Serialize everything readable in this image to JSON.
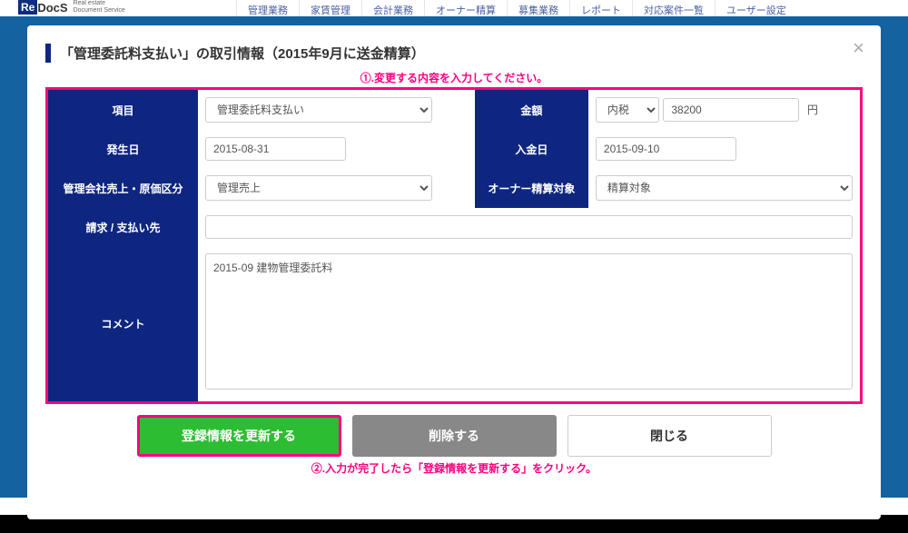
{
  "header": {
    "logo_prefix": "Re",
    "logo_main": "DocS",
    "logo_sub1": "Real estate",
    "logo_sub2": "Document Service"
  },
  "nav": [
    "管理業務",
    "家賃管理",
    "会計業務",
    "オーナー精算",
    "募集業務",
    "レポート",
    "対応案件一覧",
    "ユーザー設定"
  ],
  "modal": {
    "title": "「管理委託料支払い」の取引情報（2015年9月に送金精算）",
    "annotation1": "①.変更する内容を入力してください。",
    "annotation2": "②.入力が完了したら「登録情報を更新する」をクリック。",
    "labels": {
      "item": "項目",
      "amount": "金額",
      "occurrence_date": "発生日",
      "deposit_date": "入金日",
      "sales_category": "管理会社売上・原価区分",
      "owner_target": "オーナー精算対象",
      "billing_to": "請求 / 支払い先",
      "comment": "コメント"
    },
    "values": {
      "item": "管理委託料支払い",
      "tax": "内税",
      "amount": "38200",
      "amount_unit": "円",
      "occurrence_date": "2015-08-31",
      "deposit_date": "2015-09-10",
      "sales_category": "管理売上",
      "owner_target": "精算対象",
      "billing_to": "",
      "comment": "2015-09 建物管理委託料"
    },
    "buttons": {
      "update": "登録情報を更新する",
      "delete": "削除する",
      "close": "閉じる"
    }
  }
}
